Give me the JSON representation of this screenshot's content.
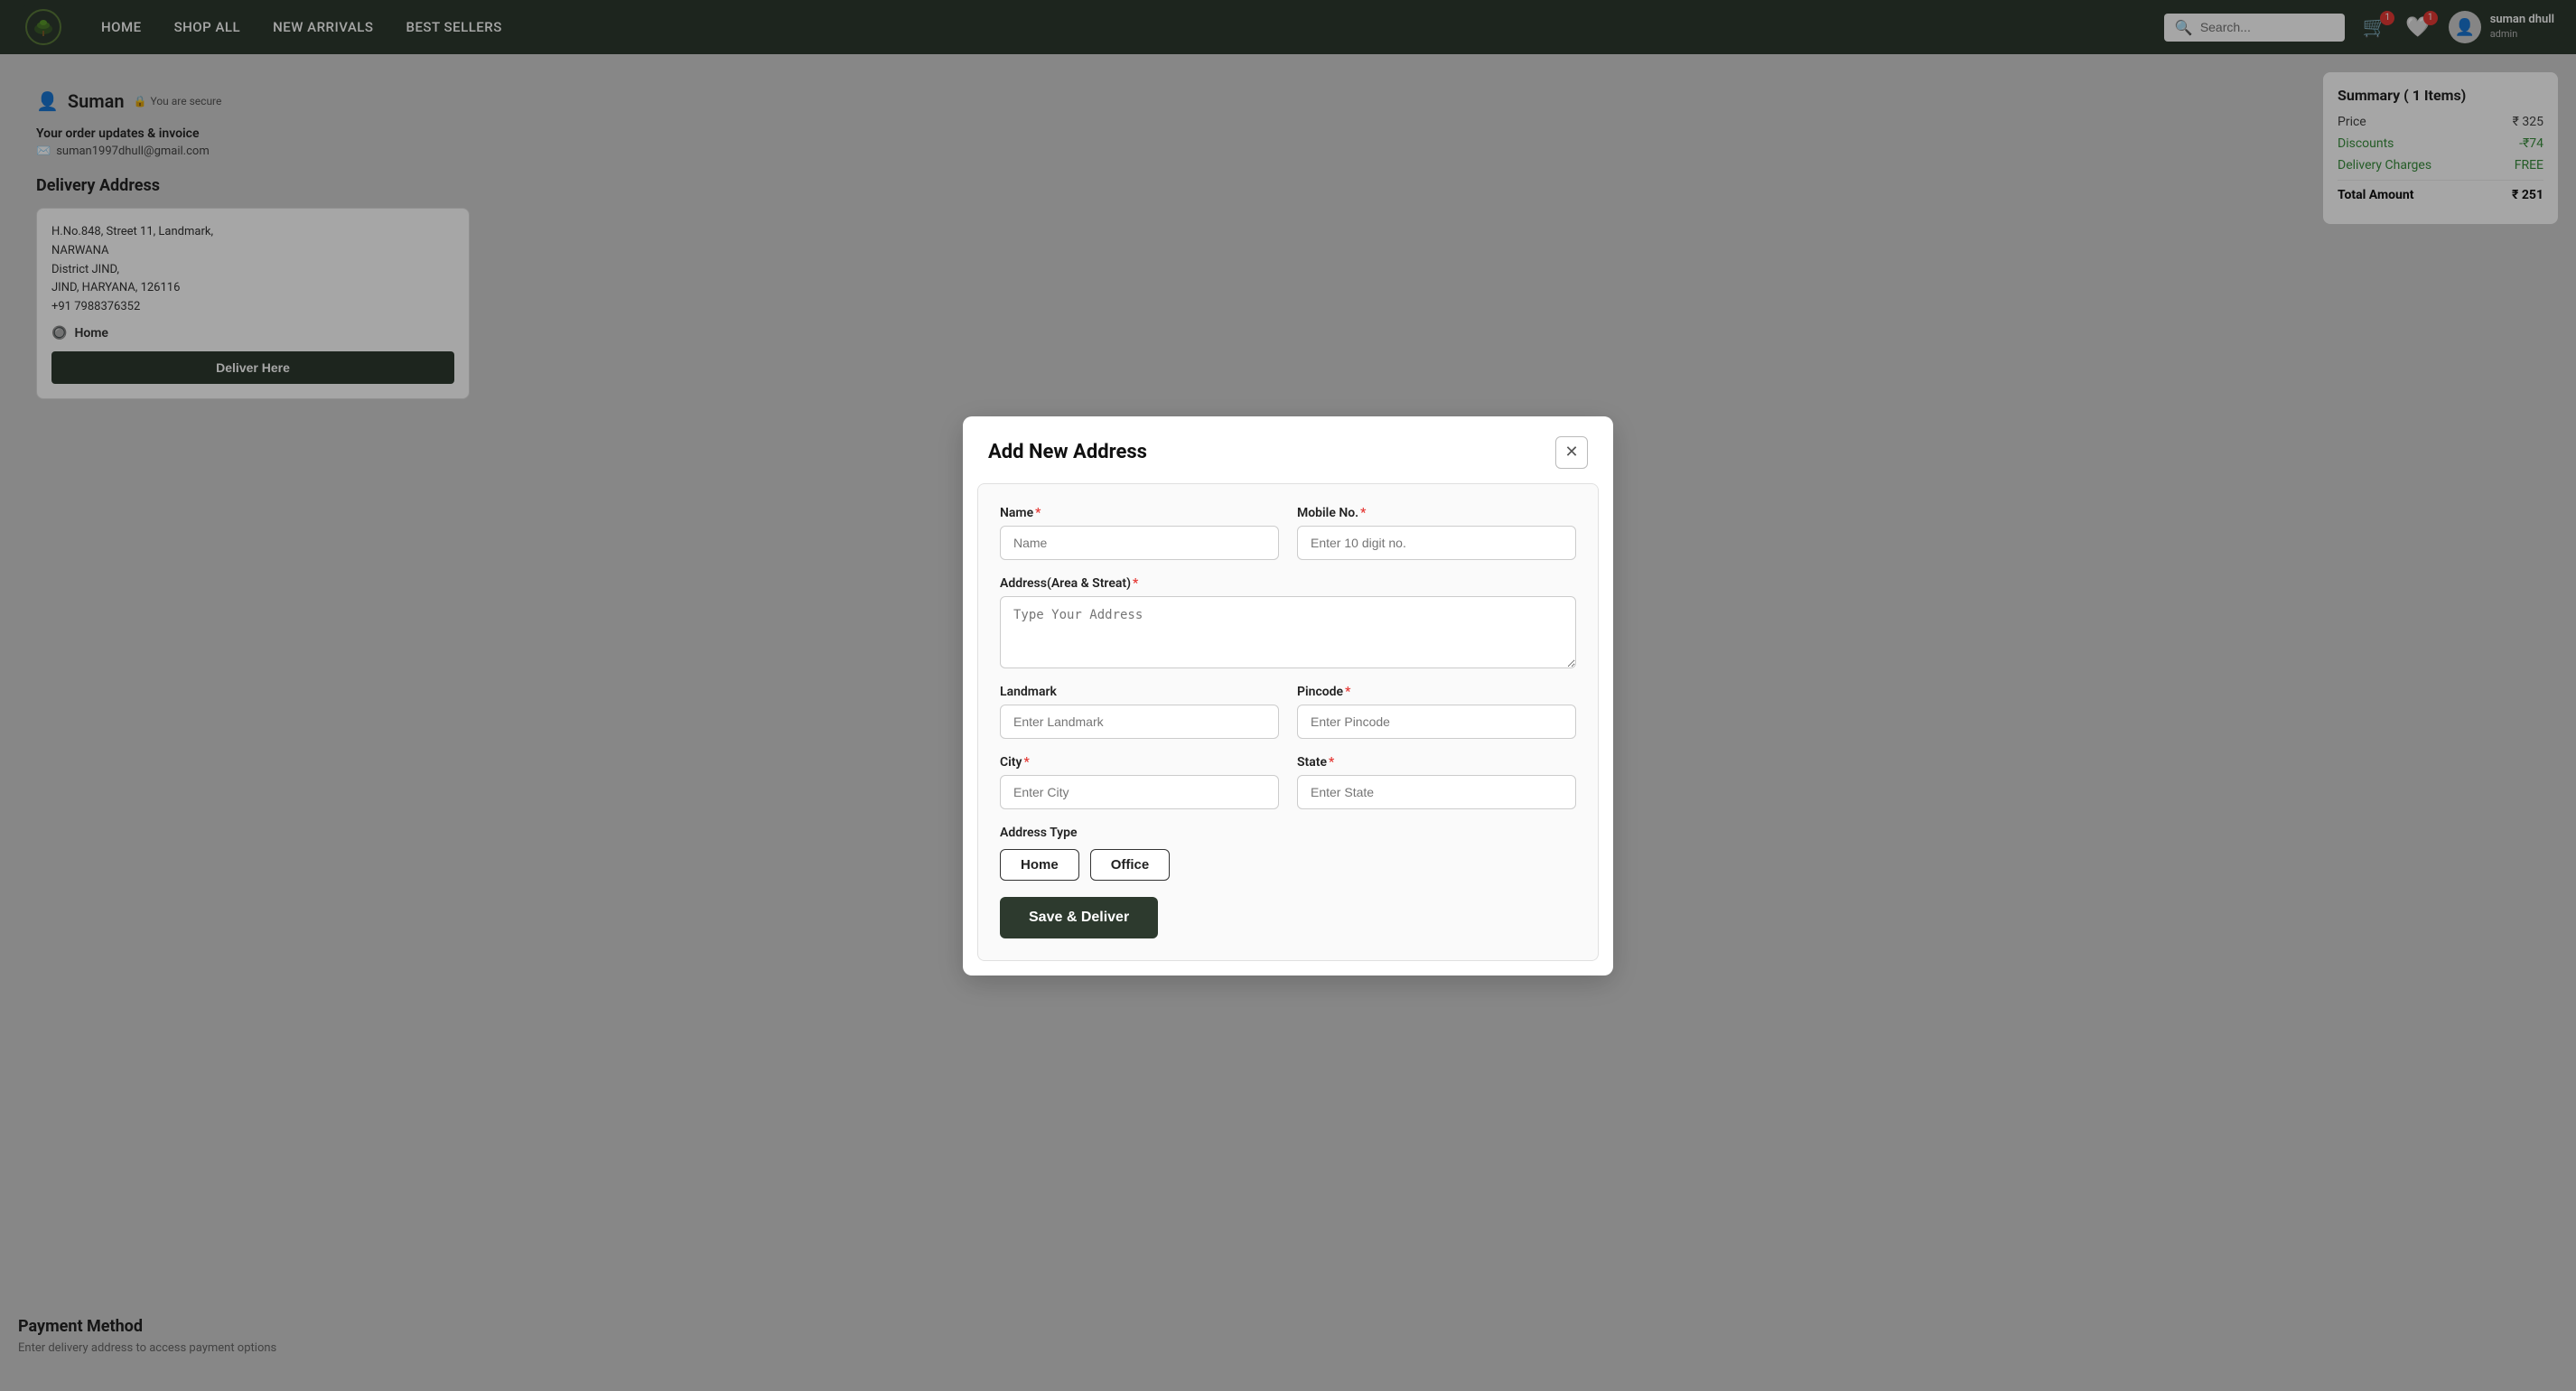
{
  "nav": {
    "logo_alt": "logo",
    "links": [
      "HOME",
      "SHOP ALL",
      "NEW ARRIVALS",
      "BEST SELLERS"
    ],
    "search_placeholder": "Search...",
    "cart_count": "1",
    "wishlist_count": "1",
    "user_name": "suman dhull",
    "user_role": "admin"
  },
  "background": {
    "user_name": "Suman",
    "secure_text": "You are secure",
    "order_updates_text": "Your order updates & invoice",
    "email": "suman1997dhull@gmail.com",
    "delivery_heading": "Delivery Address",
    "address_line1": "H.No.848, Street 11, Landmark,",
    "address_line2": "NARWANA",
    "address_line3": "District JIND,",
    "address_line4": "JIND, HARYANA, 126116",
    "address_phone": "+91 7988376352",
    "address_type_selected": "Home",
    "deliver_btn": "Deliver Here"
  },
  "summary": {
    "title": "Summary",
    "items_count": "( 1 Items)",
    "rows": [
      {
        "label": "Price",
        "value": "₹ 325",
        "type": "normal"
      },
      {
        "label": "Discounts",
        "value": "-₹74",
        "type": "discount"
      },
      {
        "label": "Delivery Charges",
        "value": "FREE",
        "type": "free"
      },
      {
        "label": "Total Amount",
        "value": "₹ 251",
        "type": "total"
      }
    ]
  },
  "payment": {
    "heading": "Payment Method",
    "subtext": "Enter delivery address to access payment options"
  },
  "modal": {
    "title": "Add New Address",
    "close_label": "✕",
    "fields": {
      "name_label": "Name",
      "name_placeholder": "Name",
      "mobile_label": "Mobile No.",
      "mobile_placeholder": "Enter 10 digit no.",
      "address_label": "Address(Area & Streat)",
      "address_placeholder": "Type Your Address",
      "landmark_label": "Landmark",
      "landmark_placeholder": "Enter Landmark",
      "pincode_label": "Pincode",
      "pincode_placeholder": "Enter Pincode",
      "city_label": "City",
      "city_placeholder": "Enter City",
      "state_label": "State",
      "state_placeholder": "Enter State"
    },
    "address_type_label": "Address Type",
    "address_type_options": [
      "Home",
      "Office"
    ],
    "save_btn": "Save & Deliver"
  }
}
